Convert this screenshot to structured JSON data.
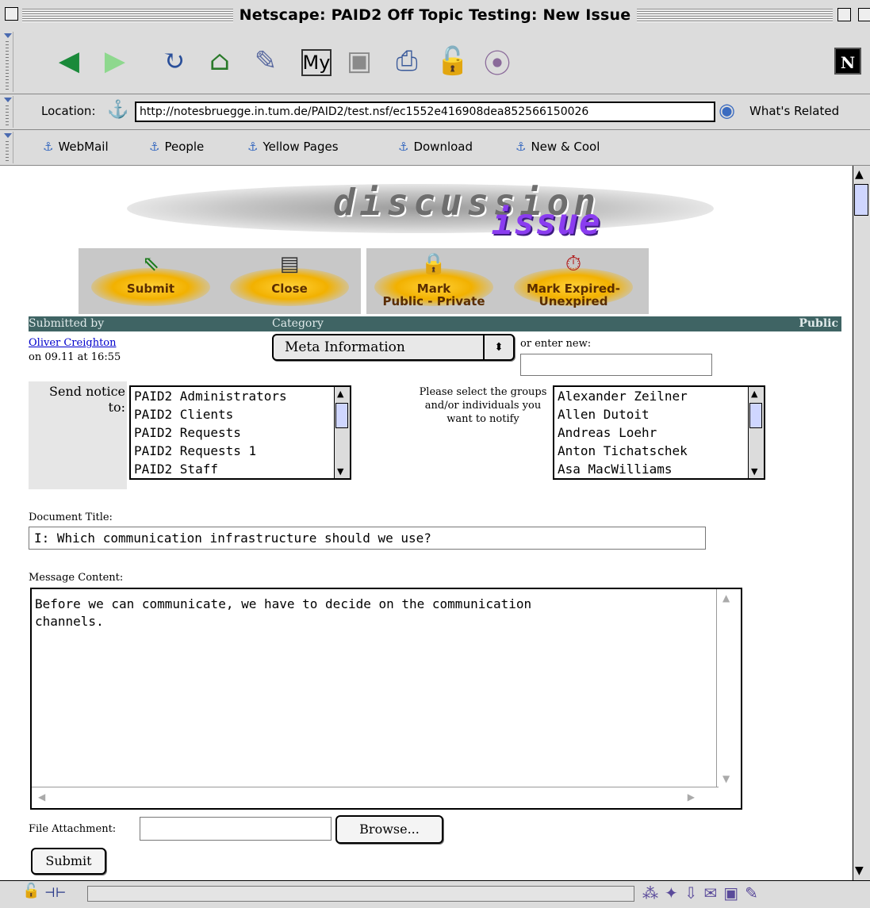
{
  "window": {
    "title": "Netscape: PAID2 Off Topic Testing: New Issue"
  },
  "navbar": {
    "buttons": [
      "back-icon",
      "forward-icon",
      "reload-icon",
      "home-icon",
      "search-icon",
      "my-netscape-icon",
      "images-icon",
      "print-icon",
      "security-icon",
      "stop-icon"
    ],
    "logo": "N"
  },
  "location": {
    "label": "Location:",
    "url": "http://notesbruegge.in.tum.de/PAID2/test.nsf/ec1552e416908dea852566150026",
    "related": "What's Related"
  },
  "personal_toolbar": {
    "items": [
      "WebMail",
      "People",
      "Yellow Pages",
      "Download",
      "New & Cool"
    ]
  },
  "banner": {
    "word1": "discussion",
    "word2": "issue"
  },
  "actions": {
    "submit": "Submit",
    "close": "Close",
    "mark_public_1": "Mark",
    "mark_public_2": "Public - Private",
    "mark_expired_1": "Mark Expired-",
    "mark_expired_2": "Unexpired"
  },
  "header": {
    "submitted_by": "Submitted by",
    "category": "Category",
    "visibility": "Public"
  },
  "submitter": {
    "name": "Oliver Creighton",
    "date": "on 09.11 at 16:55"
  },
  "category": {
    "selected": "Meta Information",
    "or_enter_new": "or enter new:",
    "new_value": ""
  },
  "notice": {
    "label": "Send notice to:",
    "groups": [
      "PAID2 Administrators",
      "PAID2 Clients",
      "PAID2 Requests",
      "PAID2 Requests 1",
      "PAID2 Staff"
    ],
    "help": "Please select the groups and/or individuals you want to notify",
    "people": [
      "Alexander Zeilner",
      "Allen Dutoit",
      "Andreas Loehr",
      "Anton Tichatschek",
      "Asa MacWilliams"
    ]
  },
  "document": {
    "title_label": "Document Title:",
    "title_value": "I: Which communication infrastructure should we use?",
    "message_label": "Message Content:",
    "message_value": "Before we can communicate, we have to decide on the communication\nchannels."
  },
  "attachment": {
    "label": "File Attachment:",
    "value": "",
    "browse": "Browse..."
  },
  "submit_button": "Submit"
}
